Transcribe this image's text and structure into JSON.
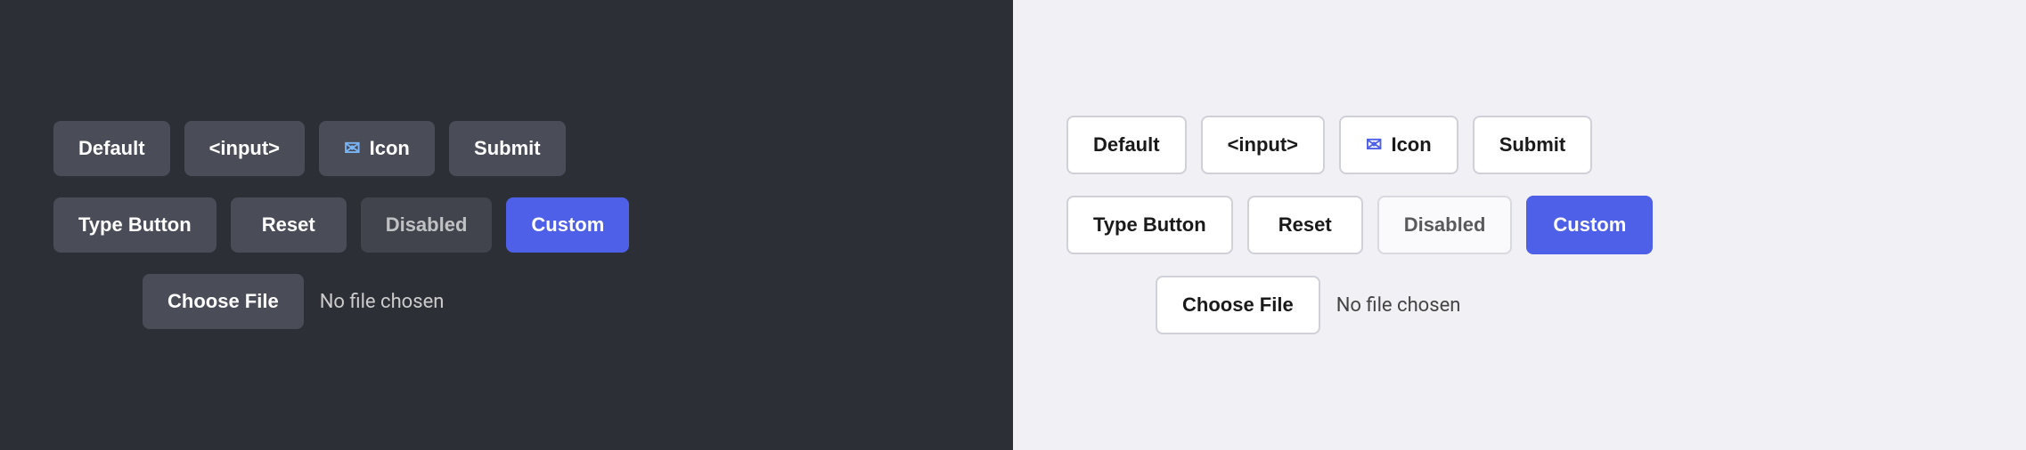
{
  "dark": {
    "row1": {
      "btn1": {
        "label": "Default"
      },
      "btn2": {
        "label": "<input>"
      },
      "btn3_icon": "✉",
      "btn3": {
        "label": "Icon"
      },
      "btn4": {
        "label": "Submit"
      }
    },
    "row2": {
      "btn1": {
        "label": "Type Button"
      },
      "btn2": {
        "label": "Reset"
      },
      "btn3": {
        "label": "Disabled"
      },
      "btn4": {
        "label": "Custom"
      }
    },
    "file": {
      "button_label": "Choose File",
      "status": "No file chosen"
    }
  },
  "light": {
    "row1": {
      "btn1": {
        "label": "Default"
      },
      "btn2": {
        "label": "<input>"
      },
      "btn3_icon": "✉",
      "btn3": {
        "label": "Icon"
      },
      "btn4": {
        "label": "Submit"
      }
    },
    "row2": {
      "btn1": {
        "label": "Type Button"
      },
      "btn2": {
        "label": "Reset"
      },
      "btn3": {
        "label": "Disabled"
      },
      "btn4": {
        "label": "Custom"
      }
    },
    "file": {
      "button_label": "Choose File",
      "status": "No file chosen"
    }
  }
}
